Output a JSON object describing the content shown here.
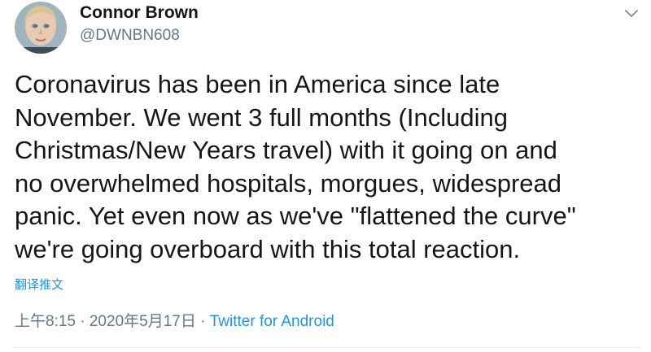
{
  "user": {
    "display_name": "Connor Brown",
    "handle": "@DWNBN608"
  },
  "tweet": {
    "text_lines": [
      "Coronavirus has been in America since late",
      "November. We went 3 full months (Including",
      "Christmas/New Years travel) with it going on and",
      "no overwhelmed hospitals, morgues, widespread",
      "panic. Yet even now as we've \"flattened the curve\"",
      "we're going overboard with this total reaction."
    ],
    "translate_label": "翻译推文",
    "timestamp": "上午8:15 · 2020年5月17日",
    "separator": " · ",
    "source": "Twitter for Android"
  },
  "icons": {
    "avatar": "user-avatar",
    "caret": "chevron-down-icon"
  },
  "colors": {
    "link": "#1b95e0",
    "secondary_text": "#657786",
    "primary_text": "#14171a"
  }
}
